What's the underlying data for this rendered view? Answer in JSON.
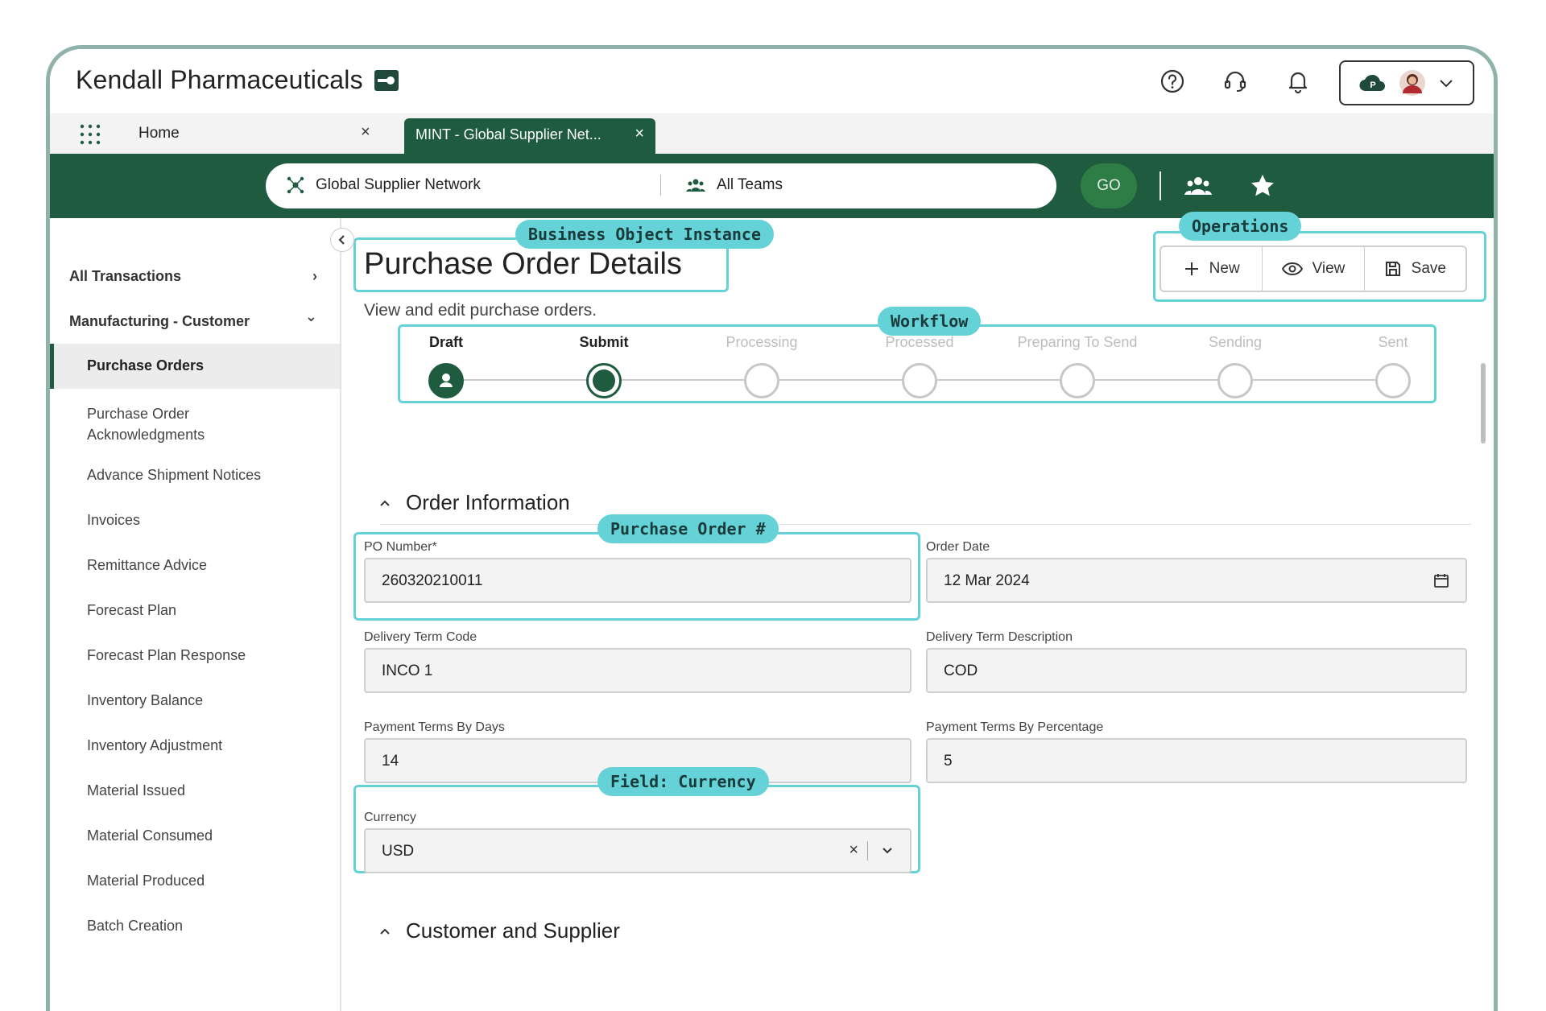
{
  "header": {
    "brand": "Kendall Pharmaceuticals",
    "icons": [
      "help-icon",
      "headset-icon",
      "bell-icon",
      "cloud-icon",
      "avatar",
      "chevron-down-icon"
    ]
  },
  "tabs": {
    "home_label": "Home",
    "close_symbol": "×",
    "active_label": "MINT - Global Supplier Net..."
  },
  "scope": {
    "network": "Global Supplier Network",
    "teams": "All Teams",
    "go_label": "GO"
  },
  "sidebar": {
    "groups": [
      {
        "label": "All Transactions",
        "chevron": "›"
      },
      {
        "label": "Manufacturing - Customer",
        "chevron": "⌄"
      }
    ],
    "active_item": "Purchase Orders",
    "items": [
      "Purchase Order\nAcknowledgments",
      "Advance Shipment Notices",
      "Invoices",
      "Remittance Advice",
      "Forecast Plan",
      "Forecast Plan Response",
      "Inventory Balance",
      "Inventory Adjustment",
      "Material Issued",
      "Material Consumed",
      "Material Produced",
      "Batch Creation"
    ]
  },
  "page": {
    "title": "Purchase Order Details",
    "subtitle": "View and edit purchase orders."
  },
  "operations": {
    "new_label": "New",
    "view_label": "View",
    "save_label": "Save"
  },
  "annotations": {
    "business_object": "Business Object Instance",
    "operations": "Operations",
    "workflow": "Workflow",
    "purchase_order": "Purchase Order #",
    "field_currency": "Field: Currency"
  },
  "workflow": {
    "steps": [
      "Draft",
      "Submit",
      "Processing",
      "Processed",
      "Preparing To Send",
      "Sending",
      "Sent"
    ],
    "completed": 1,
    "current": 2
  },
  "sections": {
    "order_info": "Order Information",
    "customer_supplier": "Customer and Supplier"
  },
  "form": {
    "po_number_label": "PO Number*",
    "po_number_value": "260320210011",
    "order_date_label": "Order Date",
    "order_date_value": "12 Mar 2024",
    "delivery_code_label": "Delivery Term Code",
    "delivery_code_value": "INCO 1",
    "delivery_desc_label": "Delivery Term Description",
    "delivery_desc_value": "COD",
    "pay_days_label": "Payment Terms By Days",
    "pay_days_value": "14",
    "pay_pct_label": "Payment Terms By Percentage",
    "pay_pct_value": "5",
    "currency_label": "Currency",
    "currency_value": "USD",
    "clear_symbol": "×"
  },
  "colors": {
    "brand_green": "#1f5c3f",
    "annotation": "#64d2d6",
    "go_button": "#2e7d46"
  }
}
